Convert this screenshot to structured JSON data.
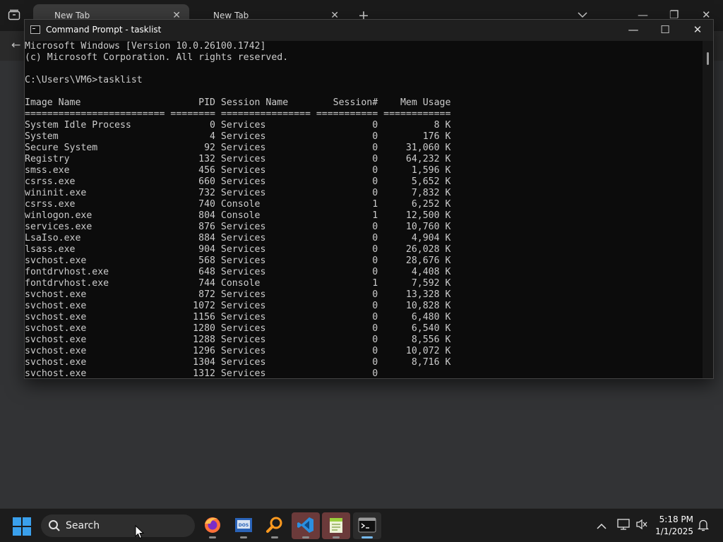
{
  "browser": {
    "tabs": [
      {
        "label": "New Tab",
        "active": true
      },
      {
        "label": "New Tab",
        "active": false
      }
    ],
    "new_tab_label": "+",
    "tab_close_glyph": "✕"
  },
  "cmd": {
    "title": "Command Prompt - tasklist",
    "controls": {
      "minimize": "—",
      "maximize": "☐",
      "close": "✕"
    },
    "lines": [
      "Microsoft Windows [Version 10.0.26100.1742]",
      "(c) Microsoft Corporation. All rights reserved.",
      "",
      "C:\\Users\\VM6>tasklist",
      "",
      "Image Name                     PID Session Name        Session#    Mem Usage",
      "========================= ======== ================ =========== ============",
      "System Idle Process              0 Services                   0          8 K",
      "System                           4 Services                   0        176 K",
      "Secure System                   92 Services                   0     31,060 K",
      "Registry                       132 Services                   0     64,232 K",
      "smss.exe                       456 Services                   0      1,596 K",
      "csrss.exe                      660 Services                   0      5,652 K",
      "wininit.exe                    732 Services                   0      7,832 K",
      "csrss.exe                      740 Console                    1      6,252 K",
      "winlogon.exe                   804 Console                    1     12,500 K",
      "services.exe                   876 Services                   0     10,760 K",
      "LsaIso.exe                     884 Services                   0      4,904 K",
      "lsass.exe                      904 Services                   0     26,028 K",
      "svchost.exe                    568 Services                   0     28,676 K",
      "fontdrvhost.exe                648 Services                   0      4,408 K",
      "fontdrvhost.exe                744 Console                    1      7,592 K",
      "svchost.exe                    872 Services                   0     13,328 K",
      "svchost.exe                   1072 Services                   0     10,828 K",
      "svchost.exe                   1156 Services                   0      6,480 K",
      "svchost.exe                   1280 Services                   0      6,540 K",
      "svchost.exe                   1288 Services                   0      8,556 K",
      "svchost.exe                   1296 Services                   0     10,072 K",
      "svchost.exe                   1304 Services                   0      8,716 K",
      "svchost.exe                   1312 Services                   0"
    ]
  },
  "taskbar": {
    "search_label": "Search",
    "apps": [
      {
        "name": "firefox-icon",
        "state": "running"
      },
      {
        "name": "dosbox-icon",
        "state": "running"
      },
      {
        "name": "magnifier-icon",
        "state": "running"
      },
      {
        "name": "vscode-icon",
        "state": "running"
      },
      {
        "name": "notepad-plus-icon",
        "state": "running"
      },
      {
        "name": "command-prompt-icon",
        "state": "active"
      }
    ],
    "clock": {
      "time": "5:18 PM",
      "date": "1/1/2025"
    }
  },
  "colors": {
    "console_text": "#cccccc",
    "console_bg": "#0c0c0c",
    "accent": "#3aa0ec"
  }
}
